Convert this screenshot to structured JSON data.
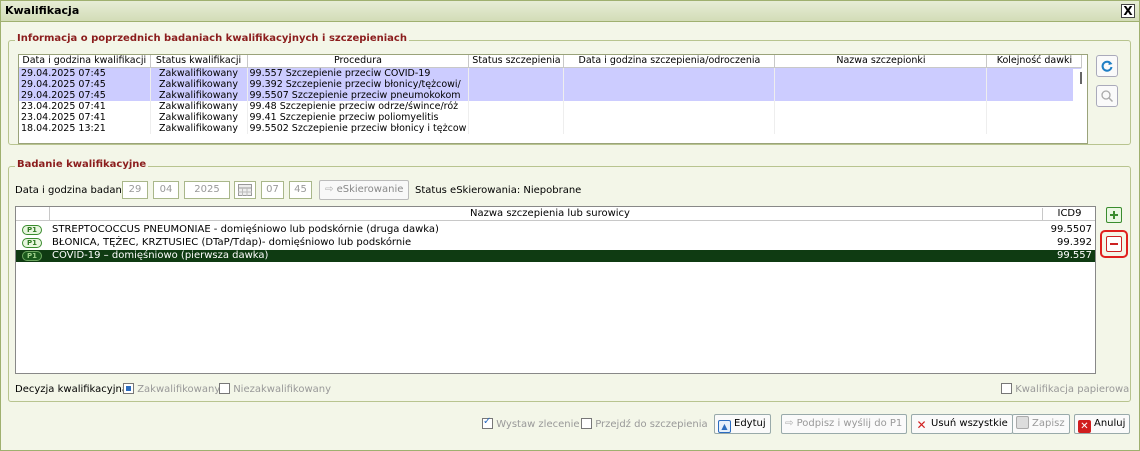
{
  "window": {
    "title": "Kwalifikacja",
    "close_label": "X"
  },
  "history": {
    "legend": "Informacja o poprzednich badaniach kwalifikacyjnych i szczepieniach",
    "columns": [
      "Data i godzina kwalifikacji",
      "Status kwalifikacji",
      "Procedura",
      "Status szczepienia",
      "Data i godzina szczepienia/odroczenia",
      "Nazwa szczepionki",
      "Kolejność dawki"
    ],
    "rows": [
      [
        "29.04.2025 07:45",
        "Zakwalifikowany",
        "99.557 Szczepienie przeciw COVID-19",
        "",
        "",
        "",
        ""
      ],
      [
        "29.04.2025 07:45",
        "Zakwalifikowany",
        "99.392 Szczepienie przeciw błonicy/tężcowi/",
        "",
        "",
        "",
        ""
      ],
      [
        "29.04.2025 07:45",
        "Zakwalifikowany",
        "99.5507 Szczepienie przeciw pneumokokom",
        "",
        "",
        "",
        ""
      ],
      [
        "23.04.2025 07:41",
        "Zakwalifikowany",
        "99.48 Szczepienie przeciw odrze/śwince/róż",
        "",
        "",
        "",
        ""
      ],
      [
        "23.04.2025 07:41",
        "Zakwalifikowany",
        "99.41 Szczepienie przeciw poliomyelitis",
        "",
        "",
        "",
        ""
      ],
      [
        "18.04.2025 13:21",
        "Zakwalifikowany",
        "99.5502 Szczepienie przeciw błonicy i tężcow",
        "",
        "",
        "",
        ""
      ]
    ]
  },
  "exam": {
    "legend": "Badanie kwalifikacyjne",
    "date_label": "Data i godzina badania",
    "day": "29",
    "month": "04",
    "year": "2025",
    "hour": "07",
    "minute": "45",
    "eskierowanie_button": "eSkierowanie",
    "status_text": "Status eSkierowania: Niepobrane",
    "table_header_name": "Nazwa szczepienia lub surowicy",
    "table_header_icd": "ICD9",
    "vaccines": [
      {
        "badge": "P1",
        "name": "STREPTOCOCCUS PNEUMONIAE - domięśniowo lub podskórnie (druga dawka)",
        "icd": "99.5507"
      },
      {
        "badge": "P1",
        "name": "BŁONICA, TĘŻEC, KRZTUSIEC (DTaP/Tdap)- domięśniowo lub podskórnie",
        "icd": "99.392"
      },
      {
        "badge": "P1",
        "name": "COVID-19 – domięśniowo (pierwsza dawka)",
        "icd": "99.557"
      }
    ],
    "decision_label": "Decyzja kwalifikacyjna",
    "option_qualified": "Zakwalifikowany",
    "option_not_qualified": "Niezakwalifikowany",
    "paper_label": "Kwalifikacja papierowa"
  },
  "footer": {
    "wystaw": "Wystaw zlecenie",
    "przejdz": "Przejdź do szczepienia",
    "edytuj": "Edytuj",
    "podpisz": "Podpisz i wyślij do P1",
    "usun": "Usuń wszystkie",
    "zapisz": "Zapisz",
    "anuluj": "Anuluj"
  },
  "colors": {
    "accent_red": "#8b1d1d",
    "selected_row": "#0f3b12",
    "highlight": "#ccccff"
  }
}
